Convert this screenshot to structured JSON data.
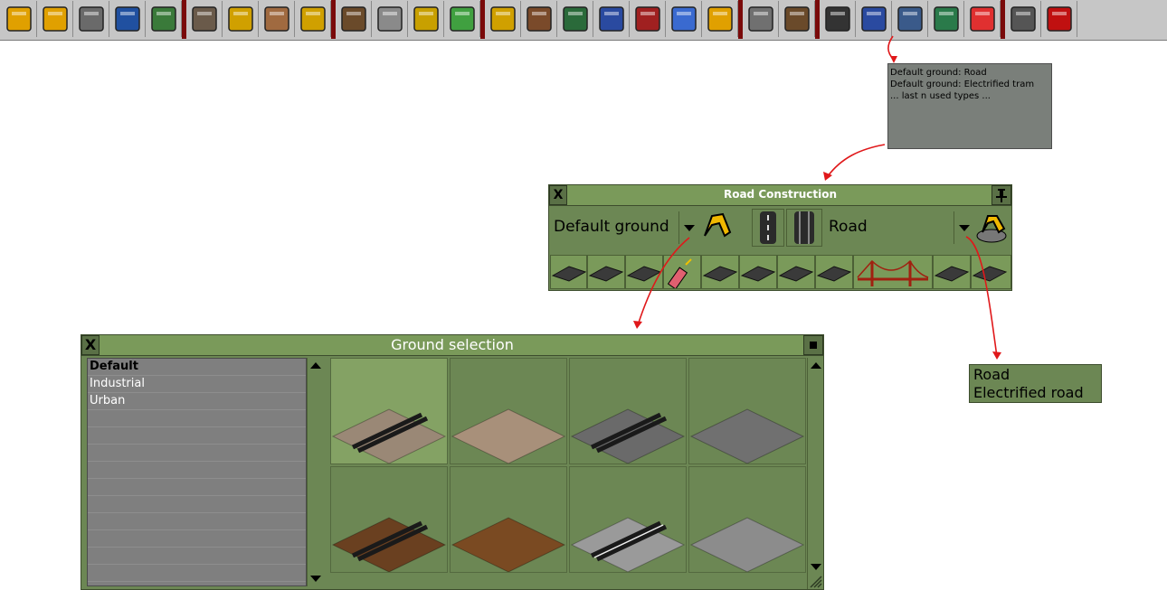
{
  "toolbar": {
    "buttons": [
      "pause-icon",
      "fast-forward-icon",
      "wrench-icon",
      "save-disk-icon",
      "map-icon",
      "buildings-icon",
      "trade-coins-icon",
      "depot-icon",
      "coins-stack-icon",
      "manager-portrait-icon",
      "office-building-icon",
      "flag-icon",
      "graph-icon",
      "trophy-icon",
      "factory-icon",
      "train-icon",
      "truck-icon",
      "ship-icon",
      "airplane-icon",
      "zoom-in-icon",
      "zoom-out-icon",
      "rail-icon",
      "road-icon",
      "tram-icon",
      "airport-icon",
      "landscape-icon",
      "music-icon",
      "newspaper-icon",
      "help-icon"
    ]
  },
  "tooltip": {
    "lines": [
      "Default ground: Road",
      "Default ground: Electrified tram",
      "... last n used types ..."
    ]
  },
  "road_window": {
    "title": "Road Construction",
    "close_label": "X",
    "ground_select": "Default ground",
    "road_select": "Road"
  },
  "ground_window": {
    "title": "Ground selection",
    "close_label": "X",
    "items": [
      "Default",
      "Industrial",
      "Urban",
      "",
      "",
      "",
      "",
      "",
      "",
      "",
      "",
      "",
      ""
    ]
  },
  "road_types": {
    "lines": [
      "Road",
      "Electrified road"
    ]
  },
  "colors": {
    "window_bg": "#6c8754",
    "title_bg": "#7a9a5a",
    "annotation_red": "#e0181a"
  }
}
